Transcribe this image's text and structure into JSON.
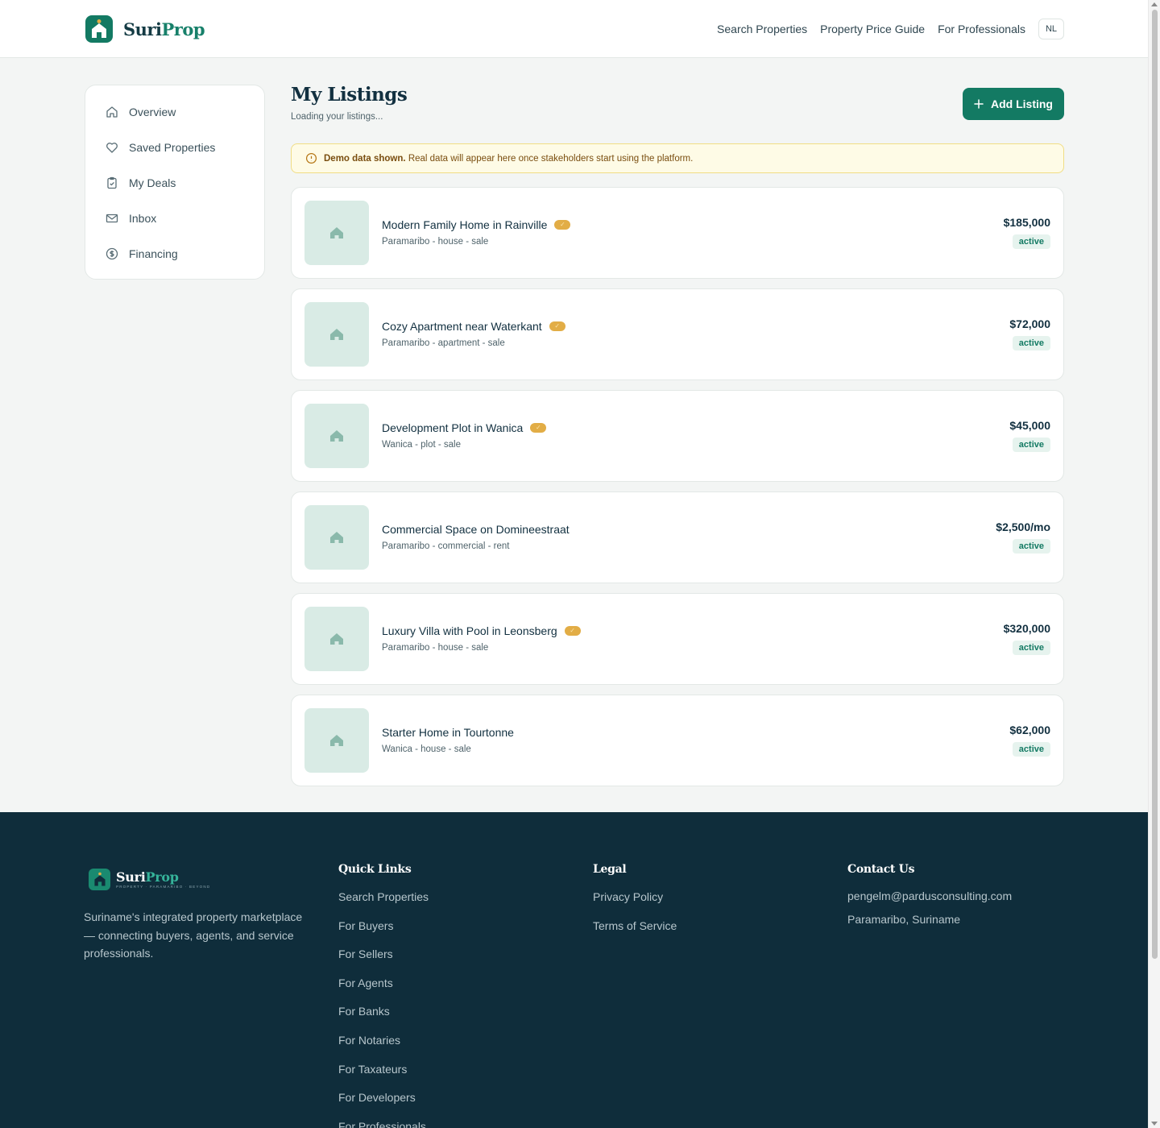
{
  "header": {
    "brand_part1": "Suri",
    "brand_part2": "Prop",
    "nav": [
      "Search Properties",
      "Property Price Guide",
      "For Professionals"
    ],
    "lang": "NL"
  },
  "sidebar": {
    "items": [
      {
        "label": "Overview",
        "icon": "home-icon"
      },
      {
        "label": "Saved Properties",
        "icon": "heart-icon"
      },
      {
        "label": "My Deals",
        "icon": "clipboard-check-icon"
      },
      {
        "label": "Inbox",
        "icon": "mail-icon"
      },
      {
        "label": "Financing",
        "icon": "dollar-circle-icon"
      }
    ]
  },
  "main": {
    "title": "My Listings",
    "subtitle": "Loading your listings...",
    "add_button": "Add Listing",
    "notice_bold": "Demo data shown.",
    "notice_text": "Real data will appear here once stakeholders start using the platform."
  },
  "listings": [
    {
      "title": "Modern Family Home in Rainville",
      "meta": "Paramaribo - house - sale",
      "price": "$185,000",
      "status": "active",
      "verified": true
    },
    {
      "title": "Cozy Apartment near Waterkant",
      "meta": "Paramaribo - apartment - sale",
      "price": "$72,000",
      "status": "active",
      "verified": true
    },
    {
      "title": "Development Plot in Wanica",
      "meta": "Wanica - plot - sale",
      "price": "$45,000",
      "status": "active",
      "verified": true
    },
    {
      "title": "Commercial Space on Domineestraat",
      "meta": "Paramaribo - commercial - rent",
      "price": "$2,500/mo",
      "status": "active",
      "verified": false
    },
    {
      "title": "Luxury Villa with Pool in Leonsberg",
      "meta": "Paramaribo - house - sale",
      "price": "$320,000",
      "status": "active",
      "verified": true
    },
    {
      "title": "Starter Home in Tourtonne",
      "meta": "Wanica - house - sale",
      "price": "$62,000",
      "status": "active",
      "verified": false
    }
  ],
  "footer": {
    "brand_part1": "Suri",
    "brand_part2": "Prop",
    "tagline": "PROPERTY · PARAMARIBO · BEYOND",
    "description": "Suriname's integrated property marketplace — connecting buyers, agents, and service professionals.",
    "quick_links_title": "Quick Links",
    "quick_links": [
      "Search Properties",
      "For Buyers",
      "For Sellers",
      "For Agents",
      "For Banks",
      "For Notaries",
      "For Taxateurs",
      "For Developers",
      "For Professionals"
    ],
    "legal_title": "Legal",
    "legal_links": [
      "Privacy Policy",
      "Terms of Service"
    ],
    "contact_title": "Contact Us",
    "email": "pengelm@pardusconsulting.com",
    "address": "Paramaribo, Suriname"
  },
  "colors": {
    "brand": "#137a63",
    "footer_bg": "#0f2d3b",
    "notice_bg": "#fefbe6",
    "verified_badge": "#e2ad46"
  }
}
